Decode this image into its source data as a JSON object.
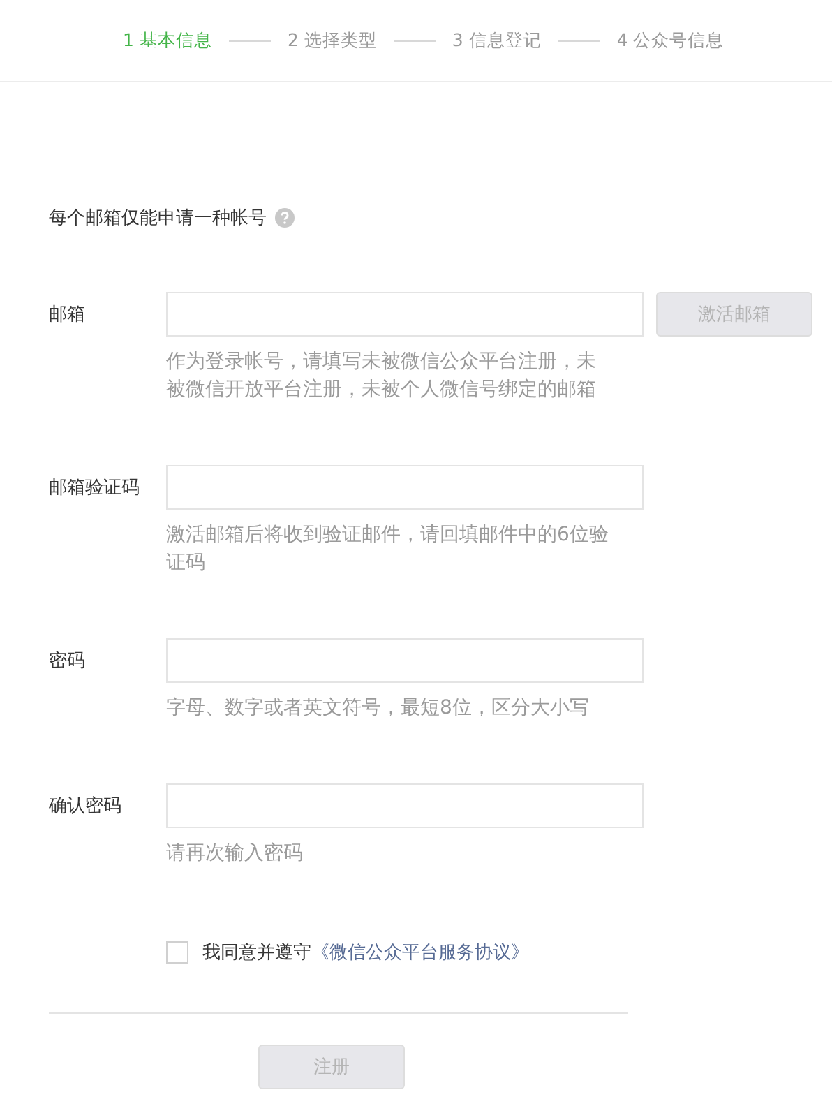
{
  "steps": [
    {
      "label": "1 基本信息",
      "selected": true
    },
    {
      "label": "2 选择类型",
      "selected": false
    },
    {
      "label": "3 信息登记",
      "selected": false
    },
    {
      "label": "4 公众号信息",
      "selected": false
    }
  ],
  "notice": "每个邮箱仅能申请一种帐号",
  "fields": [
    {
      "label": "邮箱",
      "help": "作为登录帐号，请填写未被微信公众平台注册，未被微信开放平台注册，未被个人微信号绑定的邮箱",
      "button": {
        "label": "激活邮箱",
        "disabled": true
      }
    },
    {
      "label": "邮箱验证码",
      "help": "激活邮箱后将收到验证邮件，请回填邮件中的6位验证码"
    },
    {
      "label": "密码",
      "help": "字母、数字或者英文符号，最短8位，区分大小写"
    },
    {
      "label": "确认密码",
      "help": "请再次输入密码"
    }
  ],
  "agreement": {
    "checked": false,
    "text": "我同意并遵守",
    "link": "《微信公众平台服务协议》"
  },
  "submit": {
    "label": "注册",
    "disabled": true
  }
}
